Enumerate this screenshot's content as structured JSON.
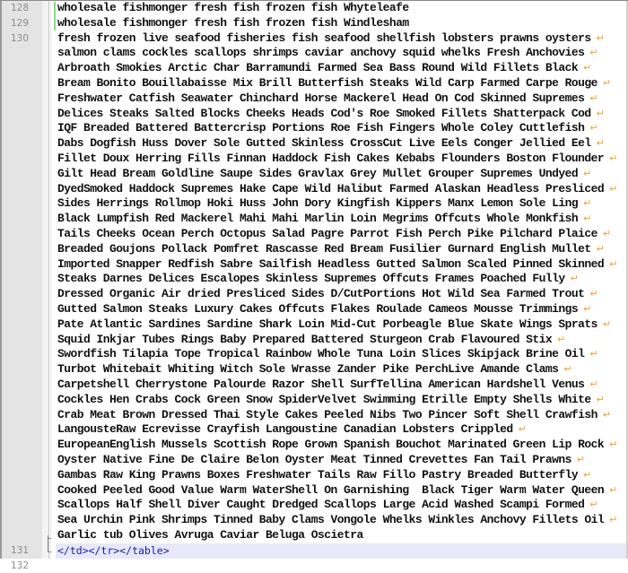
{
  "editor": {
    "wrap_symbol": "↵",
    "colors": {
      "gutter_bg": "#e4e4e4",
      "line_number": "#8c8c8c",
      "text": "#111111",
      "tag": "#1a1aa6",
      "wrap_marker": "#f0a030",
      "change_marker": "#7ee07e",
      "current_line": "#e8e8fa"
    },
    "lines": [
      {
        "number": "128",
        "segments": [
          "wholesale fishmonger fresh fish frozen fish Whyteleafe"
        ]
      },
      {
        "number": "129",
        "segments": [
          "wholesale fishmonger fresh fish frozen fish Windlesham"
        ]
      },
      {
        "number": "130",
        "segments": [
          "fresh frozen live seafood fisheries fish seafood shellfish lobsters prawns oysters",
          "salmon clams cockles scallops shrimps caviar anchovy squid whelks Fresh Anchovies",
          "Arbroath Smokies Arctic Char Barramundi Farmed Sea Bass Round Wild Fillets Black",
          "Bream Bonito Bouillabaisse Mix Brill Butterfish Steaks Wild Carp Farmed Carpe Rouge",
          "Freshwater Catfish Seawater Chinchard Horse Mackerel Head On Cod Skinned Supremes",
          "Delices Steaks Salted Blocks Cheeks Heads Cod's Roe Smoked Fillets Shatterpack Cod",
          "IQF Breaded Battered Battercrisp Portions Roe Fish Fingers Whole Coley Cuttlefish",
          "Dabs Dogfish Huss Dover Sole Gutted Skinless CrossCut Live Eels Conger Jellied Eel",
          "Fillet Doux Herring Fills Finnan Haddock Fish Cakes Kebabs Flounders Boston Flounder",
          "Gilt Head Bream Goldline Saupe Sides Gravlax Grey Mullet Grouper Supremes Undyed",
          "DyedSmoked Haddock Supremes Hake Cape Wild Halibut Farmed Alaskan Headless Presliced",
          "Sides Herrings Rollmop Hoki Huss John Dory Kingfish Kippers Manx Lemon Sole Ling",
          "Black Lumpfish Red Mackerel Mahi Mahi Marlin Loin Megrims Offcuts Whole Monkfish",
          "Tails Cheeks Ocean Perch Octopus Salad Pagre Parrot Fish Perch Pike Pilchard Plaice",
          "Breaded Goujons Pollack Pomfret Rascasse Red Bream Fusilier Gurnard English Mullet",
          "Imported Snapper Redfish Sabre Sailfish Headless Gutted Salmon Scaled Pinned Skinned",
          "Steaks Darnes Delices Escalopes Skinless Supremes Offcuts Frames Poached Fully",
          "Dressed Organic Air dried Presliced Sides D/CutPortions Hot Wild Sea Farmed Trout",
          "Gutted Salmon Steaks Luxury Cakes Offcuts Flakes Roulade Cameos Mousse Trimmings",
          "Pate Atlantic Sardines Sardine Shark Loin Mid-Cut Porbeagle Blue Skate Wings Sprats",
          "Squid Inkjar Tubes Rings Baby Prepared Battered Sturgeon Crab Flavoured Stix",
          "Swordfish Tilapia Tope Tropical Rainbow Whole Tuna Loin Slices Skipjack Brine Oil",
          "Turbot Whitebait Whiting Witch Sole Wrasse Zander Pike PerchLive Amande Clams",
          "Carpetshell Cherrystone Palourde Razor Shell SurfTellina American Hardshell Venus",
          "Cockles Hen Crabs Cock Green Snow SpiderVelvet Swimming Etrille Empty Shells White",
          "Crab Meat Brown Dressed Thai Style Cakes Peeled Nibs Two Pincer Soft Shell Crawfish",
          "LangousteRaw Ecrevisse Crayfish Langoustine Canadian Lobsters Crippled",
          "EuropeanEnglish Mussels Scottish Rope Grown Spanish Bouchot Marinated Green Lip Rock",
          "Oyster Native Fine De Claire Belon Oyster Meat Tinned Crevettes Fan Tail Prawns",
          "Gambas Raw King Prawns Boxes Freshwater Tails Raw Fillo Pastry Breaded Butterfly",
          "Cooked Peeled Good Value Warm WaterShell On Garnishing  Black Tiger Warm Water Queen",
          "Scallops Half Shell Diver Caught Dredged Scallops Large Acid Washed Scampi Formed",
          "Sea Urchin Pink Shrimps Tinned Baby Clams Vongole Whelks Winkles Anchovy Fillets Oil",
          "Garlic tub Olives Avruga Caviar Beluga Oscietra"
        ]
      },
      {
        "number": "131",
        "segments": [
          "</td></tr></table>"
        ]
      },
      {
        "number": "132",
        "segments": [
          ""
        ]
      }
    ]
  }
}
